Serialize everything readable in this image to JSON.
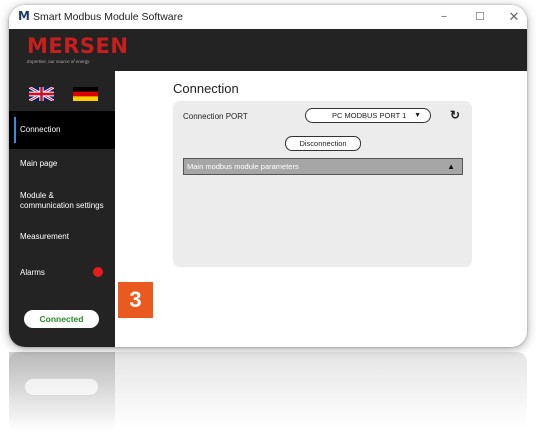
{
  "window": {
    "title": "Smart Modbus Module Software",
    "min_label": "−",
    "max_label": "☐",
    "close_label": "✕"
  },
  "brand": {
    "name": "MERSEN",
    "tagline": "Expertise, our source of energy",
    "color": "#c81e1e"
  },
  "sidebar": {
    "languages": [
      {
        "name": "English",
        "icon": "uk-flag-icon"
      },
      {
        "name": "German",
        "icon": "german-flag-icon"
      }
    ],
    "items": [
      {
        "label": "Connection",
        "active": true
      },
      {
        "label": "Main page"
      },
      {
        "label": "Module & communication settings"
      },
      {
        "label": "Measurement"
      },
      {
        "label": "Alarms",
        "alarm_color": "#e11d1d"
      }
    ],
    "status": "Connected",
    "status_color": "#2a8a2a"
  },
  "main": {
    "title": "Connection",
    "port_label": "Connection PORT",
    "port_value": "PC MODBUS PORT 1",
    "disconnect_label": "Disconnection",
    "params_label": "Main modbus module parameters"
  },
  "badge": {
    "number": "3",
    "color": "#ea5a1f"
  }
}
